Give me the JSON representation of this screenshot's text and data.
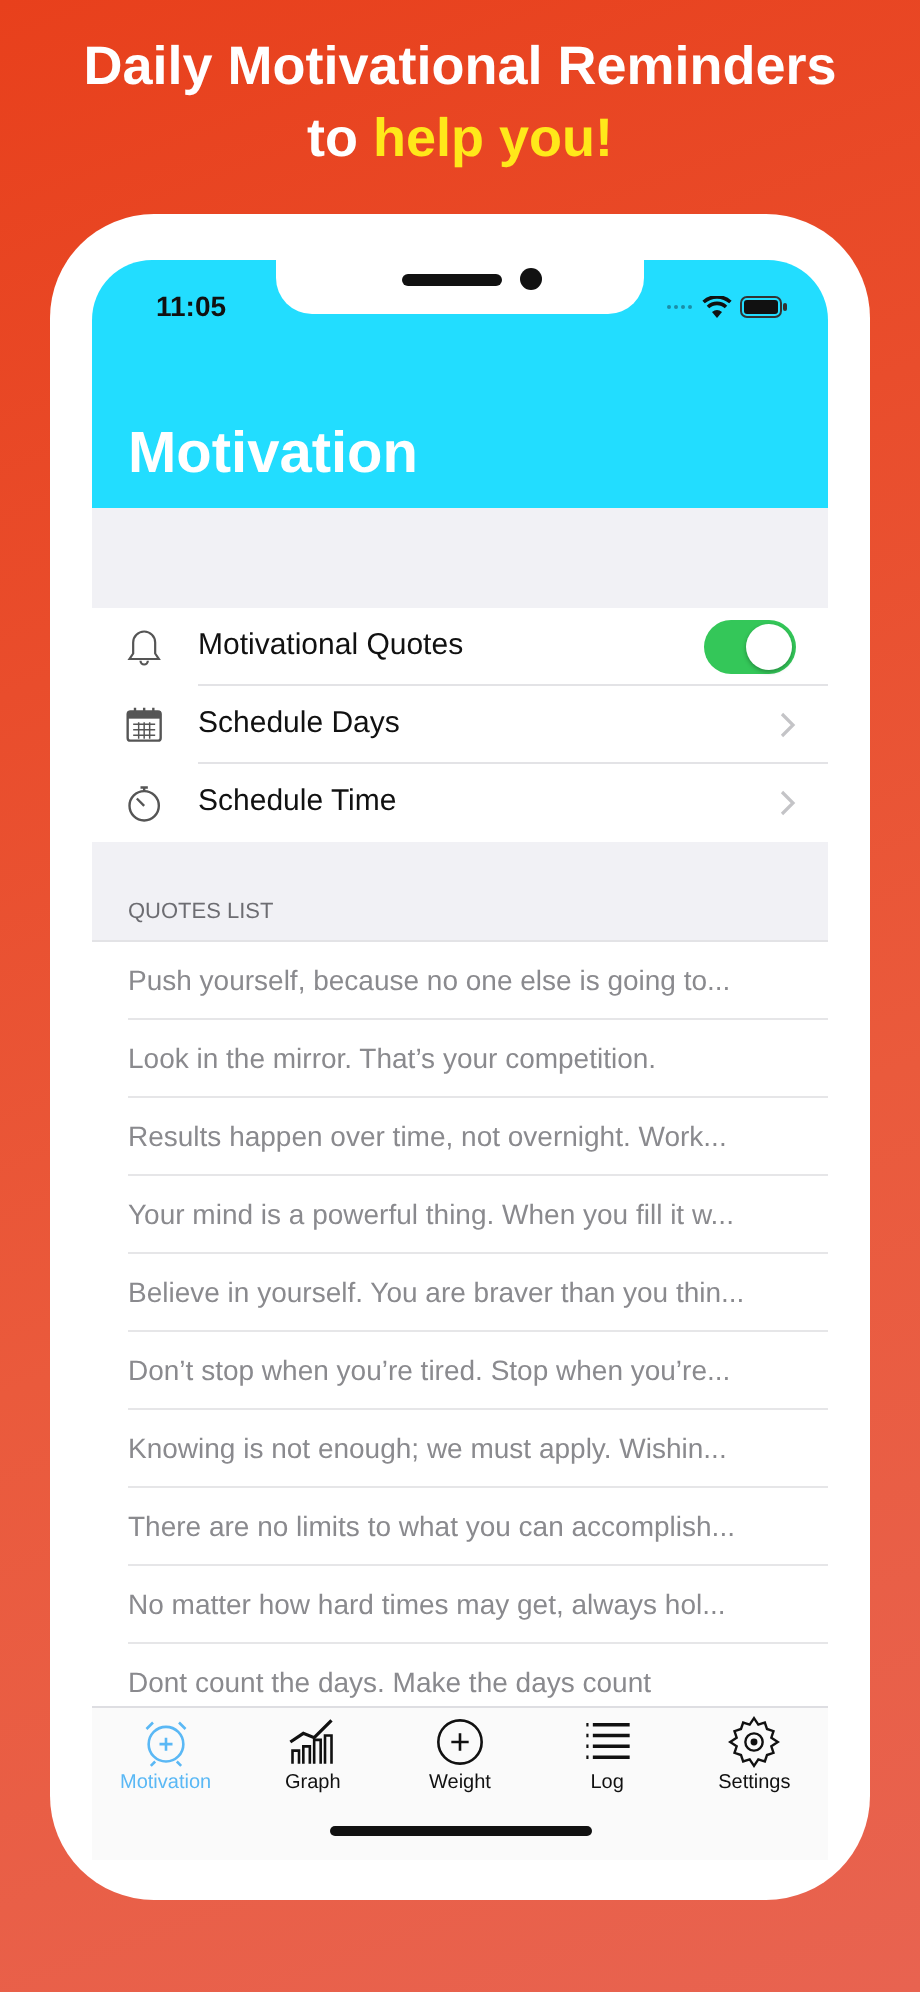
{
  "headline": {
    "line_1": "Daily Motivational Reminders",
    "line_2_lead": "to",
    "line_2_highlight": "help you!"
  },
  "status_bar": {
    "time": "11:05"
  },
  "nav": {
    "title": "Motivation"
  },
  "settings": [
    {
      "kind": "toggle",
      "label": "Motivational Quotes",
      "on": true
    },
    {
      "kind": "link",
      "label": "Schedule Days"
    },
    {
      "kind": "link",
      "label": "Schedule Time"
    }
  ],
  "quotes_section": {
    "header": "QUOTES LIST",
    "quotes": [
      "Push yourself, because no one else is going to...",
      "Look in the mirror. That’s your competition.",
      "Results happen over time, not overnight. Work...",
      "Your mind is a powerful thing. When you fill it w...",
      "Believe in yourself. You are braver than you thin...",
      "Don’t stop when you’re tired. Stop when you’re...",
      "Knowing is not enough; we must apply. Wishin...",
      "There are no limits to what you can accomplish...",
      "No matter how hard times may get, always hol...",
      "Dont count the days. Make the days count"
    ]
  },
  "tab_bar": [
    {
      "label": "Motivation",
      "selected": true
    },
    {
      "label": "Graph",
      "selected": false
    },
    {
      "label": "Weight",
      "selected": false
    },
    {
      "label": "Log",
      "selected": false
    },
    {
      "label": "Settings",
      "selected": false
    }
  ]
}
